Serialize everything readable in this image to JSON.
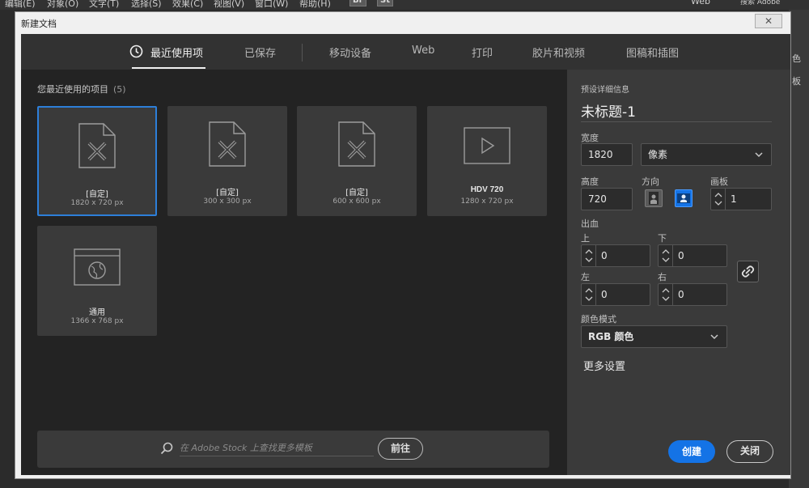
{
  "menubar": {
    "items": [
      "编辑(E)",
      "对象(O)",
      "文字(T)",
      "选择(S)",
      "效果(C)",
      "视图(V)",
      "窗口(W)",
      "帮助(H)"
    ],
    "badges": [
      "Br",
      "St"
    ],
    "workspace": "Web",
    "search": "搜索 Adobe"
  },
  "side_strip": [
    "色",
    "板"
  ],
  "dialog": {
    "title": "新建文档",
    "close_label": "✕"
  },
  "tabs": [
    {
      "label": "最近使用项",
      "active": true
    },
    {
      "label": "已保存"
    },
    {
      "label": "移动设备"
    },
    {
      "label": "Web"
    },
    {
      "label": "打印"
    },
    {
      "label": "胶片和视频"
    },
    {
      "label": "图稿和插图"
    }
  ],
  "recent": {
    "heading": "您最近使用的项目",
    "count": "(5)",
    "items": [
      {
        "name": "[自定]",
        "size": "1820 x 720 px",
        "icon": "custom-document-icon",
        "selected": true
      },
      {
        "name": "[自定]",
        "size": "300 x 300 px",
        "icon": "custom-document-icon"
      },
      {
        "name": "[自定]",
        "size": "600 x 600 px",
        "icon": "custom-document-icon"
      },
      {
        "name": "HDV 720",
        "size": "1280 x 720 px",
        "icon": "video-icon"
      },
      {
        "name": "通用",
        "size": "1366 x 768 px",
        "icon": "web-globe-icon"
      }
    ]
  },
  "stock": {
    "placeholder": "在 Adobe Stock 上查找更多模板",
    "go_label": "前往"
  },
  "details": {
    "section_label": "预设详细信息",
    "doc_title": "未标题-1",
    "width_label": "宽度",
    "width_value": "1820",
    "unit": "像素",
    "height_label": "高度",
    "height_value": "720",
    "orientation_label": "方向",
    "artboards_label": "画板",
    "artboards_value": "1",
    "bleed_label": "出血",
    "bleed_top_label": "上",
    "bleed_top": "0",
    "bleed_bottom_label": "下",
    "bleed_bottom": "0",
    "bleed_left_label": "左",
    "bleed_left": "0",
    "bleed_right_label": "右",
    "bleed_right": "0",
    "color_mode_label": "颜色模式",
    "color_mode": "RGB 颜色",
    "more_settings": "更多设置",
    "create_label": "创建",
    "close_label": "关闭"
  },
  "colors": {
    "accent": "#1473e6",
    "selection": "#2d7fd9"
  }
}
